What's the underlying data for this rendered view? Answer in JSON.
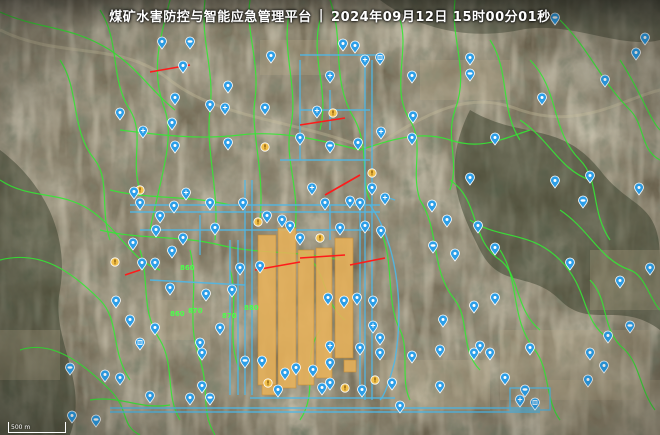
{
  "title": {
    "platform": "煤矿水害防控与智能应急管理平台",
    "separator": "|",
    "datetime": "2024年09月12日 15时00分01秒"
  },
  "scale_bar": {
    "label": "500 m"
  },
  "colors": {
    "terrain_base": "#7a7058",
    "terrain_light": "#b8a987",
    "valley_dark": "#2f3a24",
    "drainage": "#34e834",
    "roadway": "#4fb7e6",
    "working_face": "#e8b25a",
    "fault": "#ff1a1a",
    "marker_blue": "#2d9fe8",
    "marker_warning": "#f2c04a",
    "elevation_text": "#4cff4c"
  },
  "elevation_labels": [
    {
      "text": "860",
      "name": "contour-label-860-a"
    },
    {
      "text": "870",
      "name": "contour-label-870"
    },
    {
      "text": "870",
      "name": "contour-label-870-b"
    },
    {
      "text": "880",
      "name": "contour-label-880"
    },
    {
      "text": "860",
      "name": "contour-label-860-b"
    }
  ],
  "marker_types": [
    {
      "type": "drop",
      "icon": "water-drop-icon"
    },
    {
      "type": "cross",
      "icon": "monitoring-station-icon"
    },
    {
      "type": "fish",
      "icon": "water-body-icon"
    },
    {
      "type": "grid",
      "icon": "pump-station-icon"
    },
    {
      "type": "warn",
      "icon": "warning-point-icon"
    }
  ]
}
